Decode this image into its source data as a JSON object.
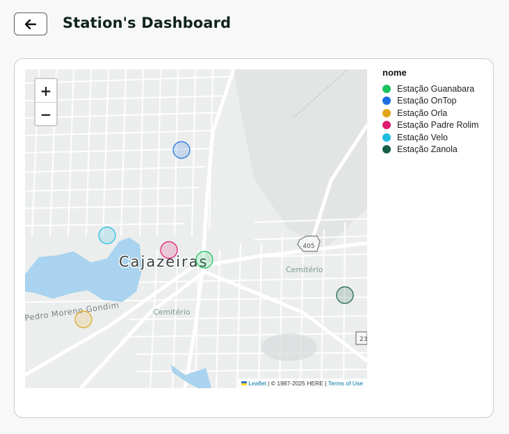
{
  "header": {
    "back_icon": "arrow-left-icon",
    "title": "Station's Dashboard"
  },
  "map": {
    "zoom_in": "+",
    "zoom_out": "−",
    "labels": {
      "city": "Cajazeiras",
      "street": "Pedro Moreno Gondim",
      "cemetery_1": "Cemitério",
      "cemetery_2": "Cemitério",
      "route": "405",
      "route_2": "23"
    },
    "attribution": {
      "leaflet": "Leaflet",
      "copyright": " | © 1987-2025 HERE | ",
      "terms": "Terms of Use"
    },
    "markers": [
      {
        "name": "Estação OnTop",
        "color": "#1a6ee0"
      },
      {
        "name": "Estação Velo",
        "color": "#1fbde0"
      },
      {
        "name": "Estação Padre Rolim",
        "color": "#e01a6e"
      },
      {
        "name": "Estação Guanabara",
        "color": "#19c160"
      },
      {
        "name": "Estação Zanola",
        "color": "#155e45"
      },
      {
        "name": "Estação Orla",
        "color": "#e0a51a"
      }
    ]
  },
  "legend": {
    "title": "nome",
    "items": [
      {
        "label": "Estação Guanabara",
        "color": "#19c160"
      },
      {
        "label": "Estação OnTop",
        "color": "#1a6ee0"
      },
      {
        "label": "Estação Orla",
        "color": "#e0a51a"
      },
      {
        "label": "Estação Padre Rolim",
        "color": "#e01a6e"
      },
      {
        "label": "Estação Velo",
        "color": "#1fbde0"
      },
      {
        "label": "Estação Zanola",
        "color": "#155e45"
      }
    ]
  }
}
